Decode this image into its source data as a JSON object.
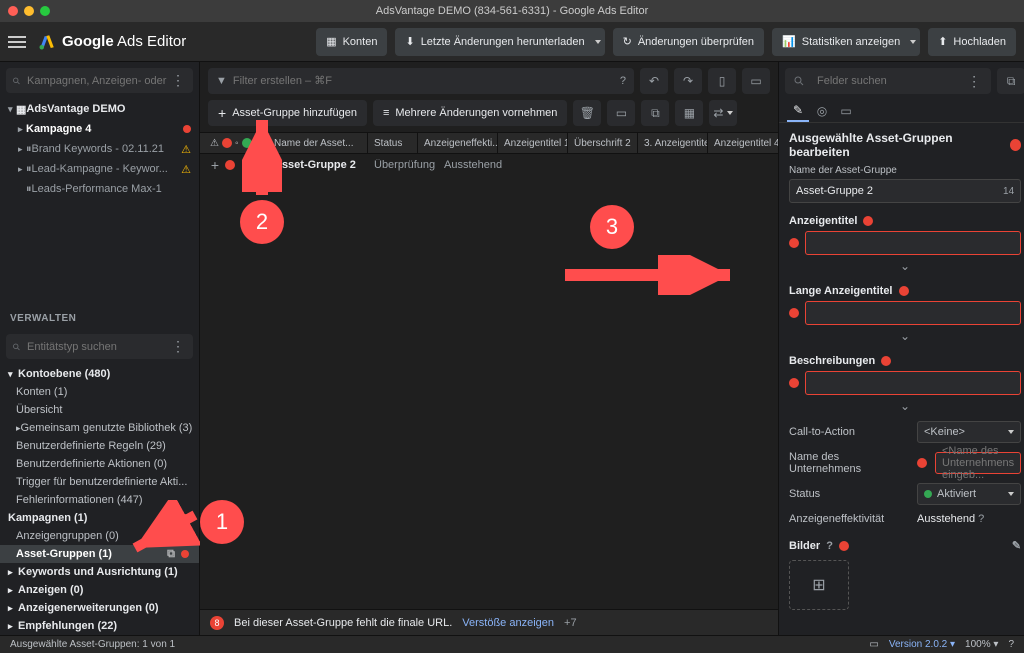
{
  "window_title": "AdsVantage DEMO (834-561-6331) - Google Ads Editor",
  "app_name_1": "Google",
  "app_name_2": " Ads Editor",
  "topbar": {
    "konten": "Konten",
    "download": "Letzte Änderungen herunterladen",
    "review": "Änderungen überprüfen",
    "stats": "Statistiken anzeigen",
    "upload": "Hochladen"
  },
  "sidebar_search_ph": "Kampagnen, Anzeigen- oder ...",
  "tree": {
    "account": "AdsVantage DEMO",
    "c1": "Kampagne 4",
    "c2": "Brand Keywords - 02.11.21",
    "c3": "Lead-Kampagne - Keywor...",
    "c4": "Leads-Performance Max-1"
  },
  "verwalten": "VERWALTEN",
  "entity_search_ph": "Entitätstyp suchen",
  "nav": {
    "konto_head": "Kontoebene (480)",
    "konten": "Konten (1)",
    "uebersicht": "Übersicht",
    "bib": "Gemeinsam genutzte Bibliothek (3)",
    "regeln": "Benutzerdefinierte Regeln (29)",
    "aktionen": "Benutzerdefinierte Aktionen (0)",
    "trigger": "Trigger für benutzerdefinierte Akti...",
    "fehler": "Fehlerinformationen (447)",
    "kampagnen": "Kampagnen (1)",
    "anzeig_gr": "Anzeigengruppen (0)",
    "asset_gr": "Asset-Gruppen (1)",
    "keywords": "Keywords und Ausrichtung (1)",
    "anzeigen": "Anzeigen (0)",
    "erweit": "Anzeigenerweiterungen (0)",
    "empf": "Empfehlungen (22)"
  },
  "filter_ph": "Filter erstellen – ⌘F",
  "add_asset_group": "Asset-Gruppe hinzufügen",
  "multi_edit": "Mehrere Änderungen vornehmen",
  "table": {
    "h_name": "Name der Asset...",
    "h_status": "Status",
    "h_eff": "Anzeigeneffekti...",
    "h_at1": "Anzeigentitel 1",
    "h_at2": "Überschrift 2",
    "h_at3": "3. Anzeigentitel",
    "h_at4": "Anzeigentitel 4",
    "row_name": "Asset-Gruppe 2",
    "row_status": "Überprüfung st...",
    "row_eff": "Ausstehend"
  },
  "alert": {
    "count": "8",
    "msg": "Bei dieser Asset-Gruppe fehlt die finale URL.",
    "link": "Verstöße anzeigen",
    "more": "+7"
  },
  "rp": {
    "fields_ph": "Felder suchen",
    "title": "Ausgewählte Asset-Gruppen bearbeiten",
    "name_label": "Name der Asset-Gruppe",
    "name_value": "Asset-Gruppe 2",
    "name_count": "14",
    "sec_titel": "Anzeigentitel",
    "sec_lang": "Lange Anzeigentitel",
    "sec_besch": "Beschreibungen",
    "cta_k": "Call-to-Action",
    "cta_v": "<Keine>",
    "biz_k": "Name des Unternehmens",
    "biz_ph": "<Name des Unternehmens eingeb...",
    "status_k": "Status",
    "status_v": "Aktiviert",
    "eff_k": "Anzeigeneffektivität",
    "eff_v": "Ausstehend",
    "bilder": "Bilder"
  },
  "status_left": "Ausgewählte Asset-Gruppen: 1 von 1",
  "status_version": "Version 2.0.2",
  "status_zoom": "100%",
  "annotations": {
    "n1": "1",
    "n2": "2",
    "n3": "3"
  }
}
